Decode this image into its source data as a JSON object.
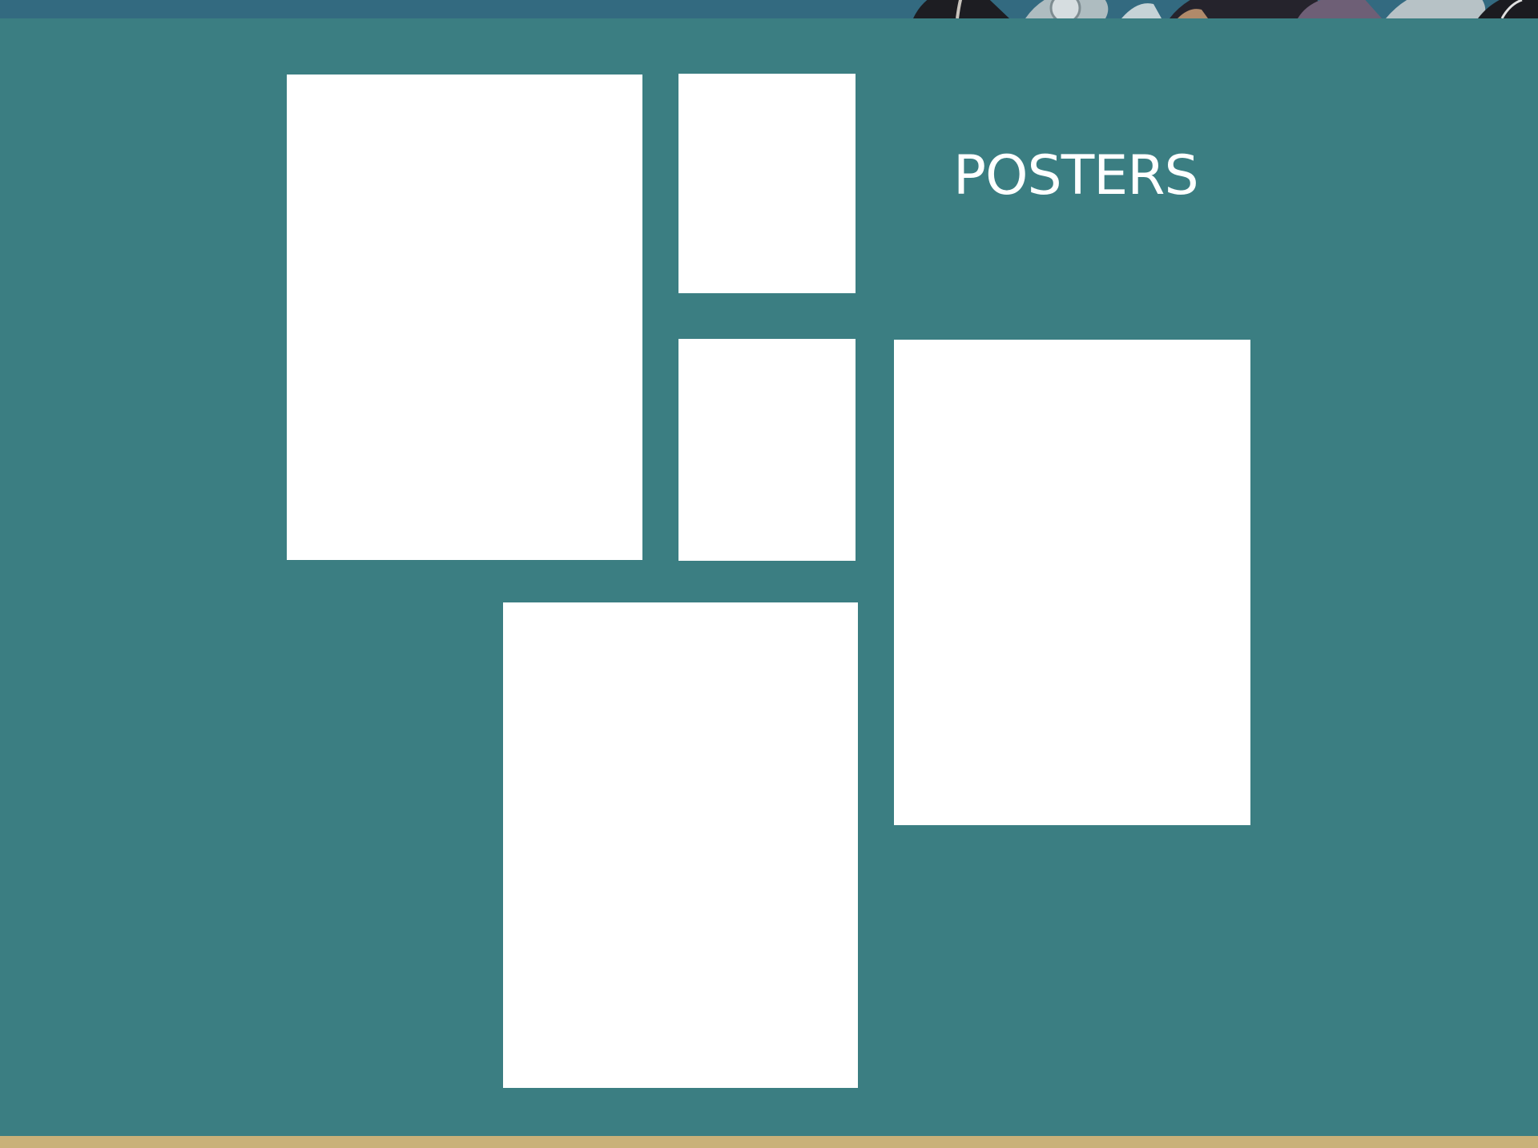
{
  "header": {
    "banner_image": "banner-artwork-icon"
  },
  "section": {
    "title": "POSTERS"
  },
  "posters": [
    {
      "name": "poster-1",
      "content": ""
    },
    {
      "name": "poster-2",
      "content": ""
    },
    {
      "name": "poster-3",
      "content": ""
    },
    {
      "name": "poster-4",
      "content": ""
    },
    {
      "name": "poster-5",
      "content": ""
    }
  ],
  "colors": {
    "background": "#3b7e82",
    "top_strip": "#336a80",
    "bottom_strip": "#c9b179",
    "poster_fill": "#ffffff",
    "title_text": "#ffffff"
  }
}
